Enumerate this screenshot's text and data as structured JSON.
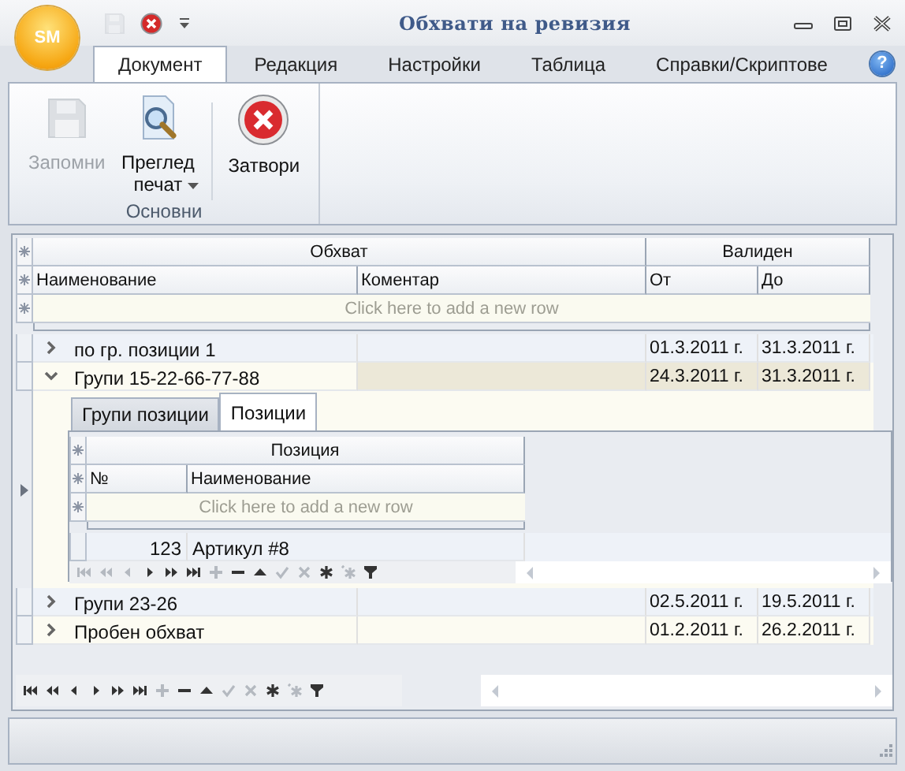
{
  "window": {
    "title": "Обхвати на ревизия"
  },
  "app_button": {
    "label": "SM"
  },
  "quick_access": [
    {
      "kind": "save",
      "disabled": true
    },
    {
      "kind": "close",
      "disabled": false
    },
    {
      "kind": "customize",
      "disabled": false
    }
  ],
  "tabs": [
    {
      "label": "Документ",
      "selected": true
    },
    {
      "label": "Редакция",
      "selected": false
    },
    {
      "label": "Настройки",
      "selected": false
    },
    {
      "label": "Таблица",
      "selected": false
    },
    {
      "label": "Справки/Скриптове",
      "selected": false
    }
  ],
  "help_button": {
    "label": "?"
  },
  "ribbon_group": {
    "label": "Основни",
    "buttons": [
      {
        "kind": "save",
        "label": "Запомни",
        "disabled": true,
        "dropdown": false
      },
      {
        "kind": "preview",
        "label": "Преглед печат",
        "disabled": false,
        "dropdown": true
      },
      {
        "kind": "close",
        "label": "Затвори",
        "disabled": false,
        "dropdown": false
      }
    ]
  },
  "grid": {
    "bands": [
      {
        "label": "Обхват"
      },
      {
        "label": "Валиден"
      }
    ],
    "columns": [
      "Наименование",
      "Коментар",
      "От",
      "До"
    ],
    "new_row_prompt": "Click here to add a new row",
    "rows": [
      {
        "name": "по гр. позиции 1",
        "from": "01.3.2011 г.",
        "to": "31.3.2011 г.",
        "expanded": false,
        "selected": false
      },
      {
        "name": "Групи 15-22-66-77-88",
        "from": "24.3.2011 г.",
        "to": "31.3.2011 г.",
        "expanded": true,
        "selected": true,
        "detail": {
          "tabs": [
            {
              "label": "Групи позиции",
              "selected": false
            },
            {
              "label": "Позиции",
              "selected": true
            }
          ],
          "band": "Позиция",
          "columns": [
            "№",
            "Наименование"
          ],
          "new_row_prompt": "Click here to add a new row",
          "rows": [
            {
              "number": "123",
              "name": "Артикул #8"
            }
          ],
          "navigator": [
            {
              "kind": "first",
              "disabled": true
            },
            {
              "kind": "prev-page",
              "disabled": true
            },
            {
              "kind": "prev",
              "disabled": true
            },
            {
              "kind": "next",
              "disabled": false
            },
            {
              "kind": "next-page",
              "disabled": false
            },
            {
              "kind": "last",
              "disabled": false
            },
            {
              "kind": "append",
              "disabled": true
            },
            {
              "kind": "delete",
              "disabled": false
            },
            {
              "kind": "edit",
              "disabled": false
            },
            {
              "kind": "end-edit",
              "disabled": true
            },
            {
              "kind": "cancel",
              "disabled": true
            },
            {
              "kind": "new",
              "disabled": false
            },
            {
              "kind": "new-copy",
              "disabled": true
            },
            {
              "kind": "filter",
              "disabled": false
            }
          ]
        }
      },
      {
        "name": "Групи 23-26",
        "from": "02.5.2011 г.",
        "to": "19.5.2011 г.",
        "expanded": false,
        "selected": false
      },
      {
        "name": "Пробен обхват",
        "from": "01.2.2011 г.",
        "to": "26.2.2011 г.",
        "expanded": false,
        "selected": false
      }
    ],
    "navigator": [
      {
        "kind": "first",
        "disabled": false
      },
      {
        "kind": "prev-page",
        "disabled": false
      },
      {
        "kind": "prev",
        "disabled": false
      },
      {
        "kind": "next",
        "disabled": false
      },
      {
        "kind": "next-page",
        "disabled": false
      },
      {
        "kind": "last",
        "disabled": false
      },
      {
        "kind": "append",
        "disabled": true
      },
      {
        "kind": "delete",
        "disabled": false
      },
      {
        "kind": "edit",
        "disabled": false
      },
      {
        "kind": "end-edit",
        "disabled": true
      },
      {
        "kind": "cancel",
        "disabled": true
      },
      {
        "kind": "new",
        "disabled": false
      },
      {
        "kind": "new-copy",
        "disabled": true
      },
      {
        "kind": "filter",
        "disabled": false
      }
    ]
  }
}
